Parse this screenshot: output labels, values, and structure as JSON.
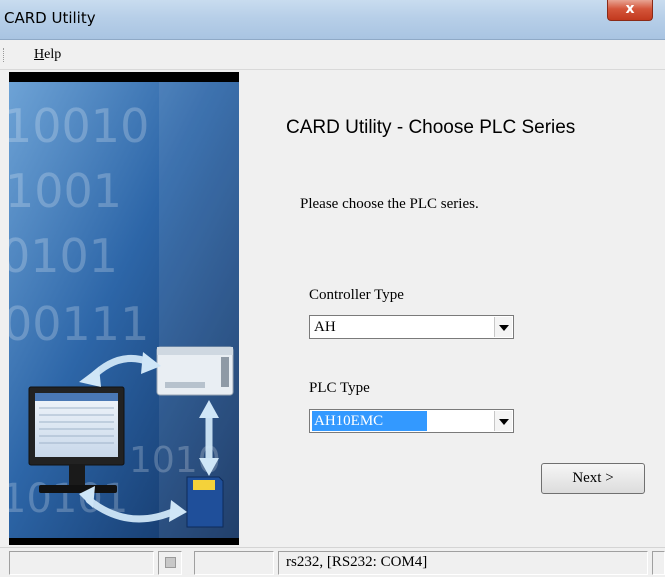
{
  "window": {
    "title": "CARD Utility",
    "close_glyph": "x"
  },
  "menu": {
    "help_first": "H",
    "help_rest": "elp"
  },
  "banner": {
    "background_color": "#1d3e6a",
    "digits": [
      "10010",
      "1001",
      "0101",
      "00111",
      "1010",
      "10101"
    ]
  },
  "main": {
    "heading": "CARD Utility - Choose PLC Series",
    "instruction": "Please choose the PLC series.",
    "controller_type_label": "Controller Type",
    "controller_type_value": "AH",
    "plc_type_label": "PLC Type",
    "plc_type_value": "AH10EMC",
    "next_button": "Next >"
  },
  "status": {
    "connection": "rs232, [RS232: COM4]"
  }
}
